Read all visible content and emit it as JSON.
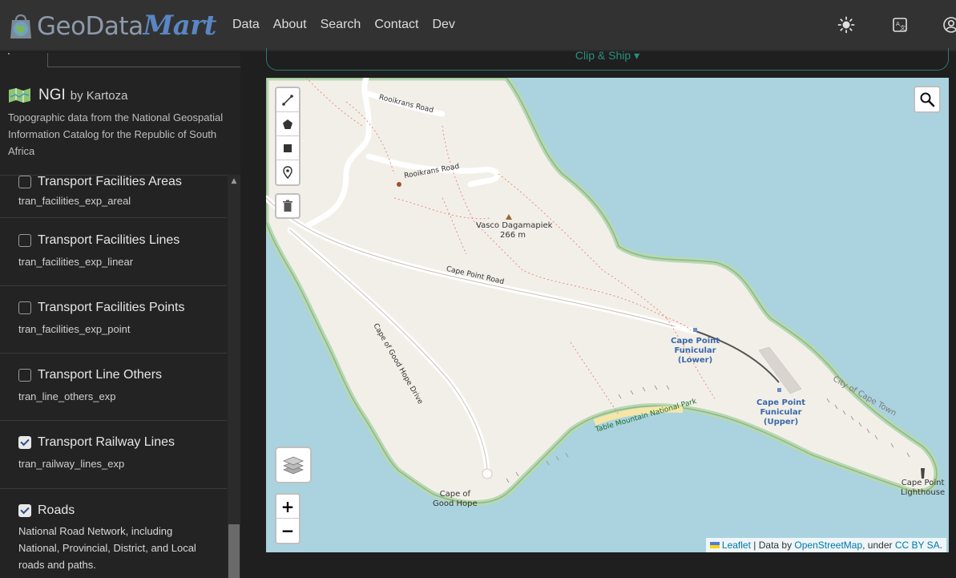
{
  "header": {
    "logo_text_plain": "GeoData",
    "logo_text_accent": "Mart",
    "nav": [
      "Data",
      "About",
      "Search",
      "Contact",
      "Dev"
    ],
    "icons": [
      "sun-icon",
      "translate-icon",
      "user-icon"
    ]
  },
  "source": {
    "name": "NGI",
    "by": "by Kartoza",
    "description": "Topographic data from the National Geospatial Information Catalog for the Republic of South Africa"
  },
  "layers": [
    {
      "name": "Transport Facilities Areas",
      "id": "tran_facilities_exp_areal",
      "checked": false
    },
    {
      "name": "Transport Facilities Lines",
      "id": "tran_facilities_exp_linear",
      "checked": false
    },
    {
      "name": "Transport Facilities Points",
      "id": "tran_facilities_exp_point",
      "checked": false
    },
    {
      "name": "Transport Line Others",
      "id": "tran_line_others_exp",
      "checked": false
    },
    {
      "name": "Transport Railway Lines",
      "id": "tran_railway_lines_exp",
      "checked": true
    },
    {
      "name": "Roads",
      "id": "",
      "description": "National Road Network, including National, Provincial, District, and Local roads and paths.",
      "checked": true
    }
  ],
  "clip_button": {
    "label": "Clip & Ship"
  },
  "map": {
    "labels": {
      "road1": "Rooikrans Road",
      "road2": "Rooikrans Road",
      "peak": "Vasco Dagamapiek",
      "peak_elev": "266 m",
      "road3": "Cape Point Road",
      "road4": "Cape of Good Hope Drive",
      "funicular_lower": [
        "Cape Point",
        "Funicular",
        "(Lower)"
      ],
      "funicular_upper": [
        "Cape Point",
        "Funicular",
        "(Upper)"
      ],
      "city": "City of Cape Town",
      "park": "Table Mountain National Park",
      "cape": [
        "Cape of",
        "Good Hope"
      ],
      "lighthouse": [
        "Cape Point",
        "Lighthouse"
      ]
    },
    "zoom_in": "+",
    "zoom_out": "−",
    "attribution": {
      "leaflet": "Leaflet",
      "sep": " | Data by ",
      "osm": "OpenStreetMap",
      "under": ", under ",
      "license": "CC BY SA",
      "end": "."
    }
  },
  "colors": {
    "accent": "#2a8f80",
    "water": "#aad3df",
    "land": "#f2efe9",
    "logo_accent": "#5a86c2"
  }
}
